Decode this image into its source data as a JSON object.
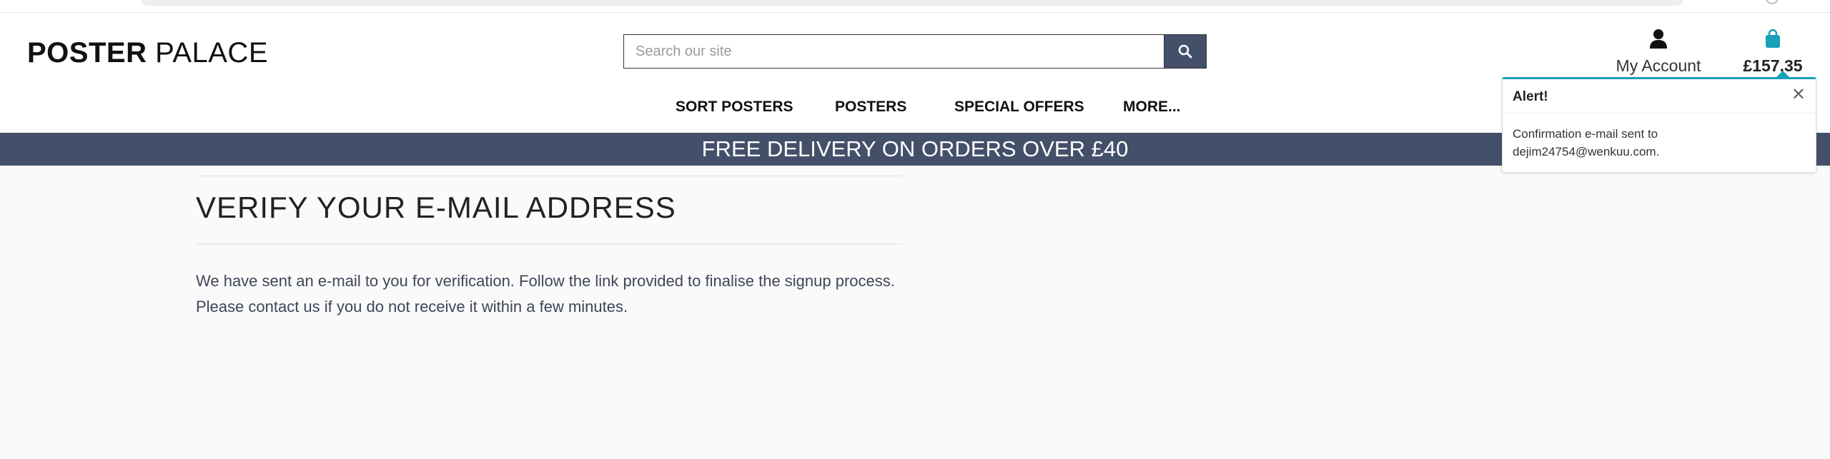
{
  "brand": {
    "logo_bold": "POSTER",
    "logo_light": "PALACE"
  },
  "search": {
    "placeholder": "Search our site",
    "button_icon": "search-icon"
  },
  "account": {
    "label": "My Account",
    "icon": "user-icon"
  },
  "bag": {
    "amount": "£157.35",
    "icon": "shopping-bag-icon",
    "icon_color": "#17a2b8"
  },
  "nav": {
    "items": [
      "SORT POSTERS",
      "POSTERS",
      "SPECIAL OFFERS",
      "MORE..."
    ]
  },
  "banner": {
    "text": "FREE DELIVERY ON ORDERS OVER £40",
    "color": "#44506a"
  },
  "main": {
    "title": "VERIFY YOUR E-MAIL ADDRESS",
    "message": "We have sent an e-mail to you for verification. Follow the link provided to finalise the signup process. Please contact us if you do not receive it within a few minutes."
  },
  "alert": {
    "title": "Alert!",
    "close": "✕",
    "message": "Confirmation e-mail sent to dejim24754@wenkuu.com.",
    "accent": "#17a2b8"
  }
}
